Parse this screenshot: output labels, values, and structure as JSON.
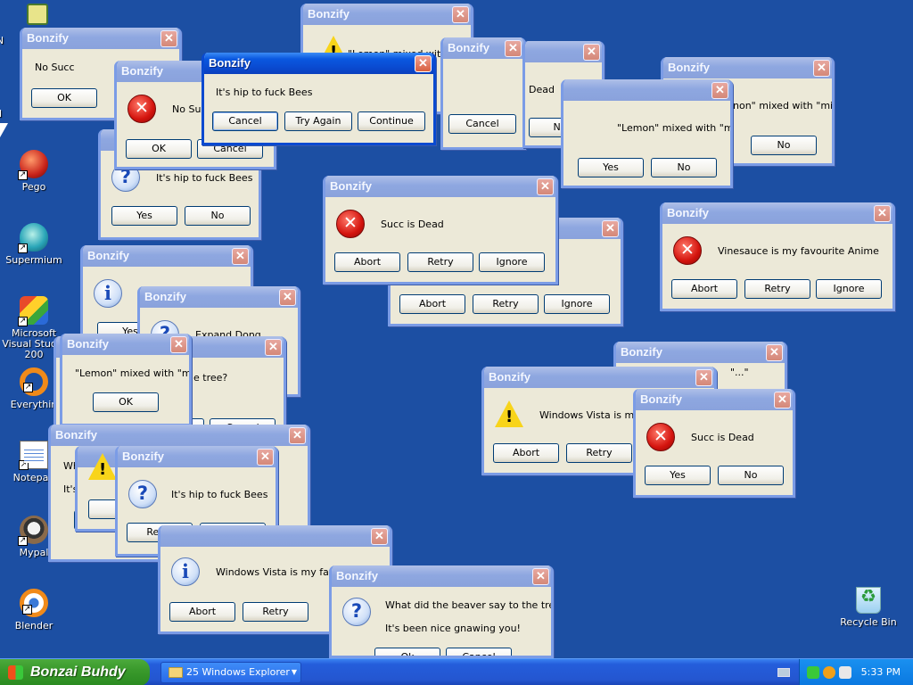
{
  "desktop": {
    "icons": [
      {
        "label": "Pego"
      },
      {
        "label": "Supermium"
      },
      {
        "label": "Microsoft Visual Studio 200"
      },
      {
        "label": "Everythin"
      },
      {
        "label": "Notepad"
      },
      {
        "label": "Mypal"
      },
      {
        "label": "Blender"
      },
      {
        "label": "Recycle Bin"
      }
    ],
    "edge_letters": [
      "N",
      "N"
    ]
  },
  "dialog_title": "Bonzify",
  "close_glyph": "✕",
  "messages": {
    "no_succ": "No Succ",
    "lemon_milk": "\"Lemon\" mixed with \"milk\"",
    "lemon_milk_clipped": "non\" mixed with \"milk\"",
    "lemon_milk_partial": "\"Lemon\" mixed with \"milk\"",
    "bees": "It's hip to fuck Bees",
    "succ_dead": "Succ is Dead",
    "dead_clipped": "Dead",
    "vinesauce": "Vinesauce is my favourite Anime",
    "expand_dong": "Expand Dong",
    "tree_clipped": "e tree?",
    "vista_clipped": "Windows Vista is my fa",
    "vista_clipped2": "Windows Vista is my favou",
    "beaver_q": "What did the beaver say to the tree?",
    "beaver_a": "It's been nice gnawing you!",
    "wh": "Wh",
    "its": "It's",
    "quote_clip": "\"...\""
  },
  "buttons": {
    "ok": "OK",
    "cancel": "Cancel",
    "try_again": "Try Again",
    "continue": "Continue",
    "yes": "Yes",
    "no": "No",
    "abort": "Abort",
    "retry": "Retry",
    "ignore": "Ignore",
    "a_clip": "A",
    "ok_clip": "Ok",
    "cancel_clip": "Cancel"
  },
  "taskbar": {
    "start_label": "Bonzai Buhdy",
    "task_button": "25 Windows Explorer",
    "clock": "5:33 PM"
  },
  "colors": {
    "desktop": "#1c4fa3",
    "active_title": "#0a4ad0",
    "inactive_title": "#8ea7e0",
    "dialog_face": "#ece9d8"
  }
}
